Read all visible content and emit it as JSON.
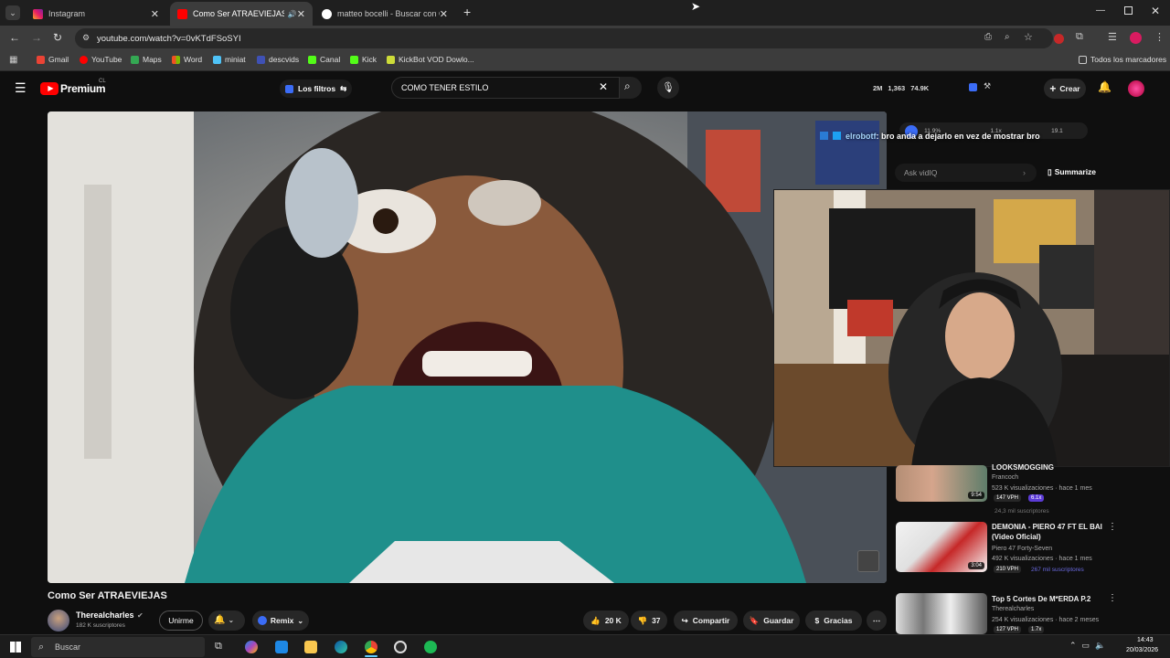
{
  "browser": {
    "tabs": [
      {
        "title": "Instagram",
        "active": false
      },
      {
        "title": "Como Ser ATRAEVIEJAS - Yo",
        "active": true
      },
      {
        "title": "matteo bocelli - Buscar con Go",
        "active": false
      }
    ],
    "url": "youtube.com/watch?v=0vKTdFSoSYI",
    "bookmarks": [
      "Gmail",
      "YouTube",
      "Maps",
      "Word",
      "miniat",
      "descvids",
      "Canal",
      "Kick",
      "KickBot VOD Dowlo..."
    ],
    "all_bookmarks": "Todos los marcadores"
  },
  "youtube": {
    "logo": "Premium",
    "logo_sup": "CL",
    "filters_label": "Los filtros",
    "search_value": "COMO TENER ESTILO",
    "stats": {
      "subs": "2M",
      "views": "1,363",
      "likes": "74.9K"
    },
    "create_label": "Crear"
  },
  "overlay": {
    "chat_user": "elrobotf",
    "chat_message": ": bro anda a dejarlo en vez de mostrar bro",
    "ask_placeholder": "Ask vidIQ",
    "summarize": "Summarize",
    "mini_stats": [
      "11.9%",
      "1.1x",
      "19.1"
    ]
  },
  "video": {
    "title": "Como Ser ATRAEVIEJAS",
    "channel": "Therealcharles",
    "subscribers": "182 K suscriptores",
    "join_label": "Unirme",
    "remix_label": "Remix",
    "likes": "20 K",
    "dislikes": "37",
    "share_label": "Compartir",
    "save_label": "Guardar",
    "thanks_label": "Gracias"
  },
  "recommendations": [
    {
      "title": "LOOKSMOGGING",
      "channel": "Francoch",
      "meta": "523 K visualizaciones · hace 1 mes",
      "duration": "9:54",
      "vph": "147 VPH",
      "ratio": "6.1x",
      "subs": "24,3 mil suscriptores"
    },
    {
      "title": "DEMONIA - PIERO 47 FT EL BAI (Video Oficial)",
      "channel": "Piero 47 Forty-Seven",
      "meta": "492 K visualizaciones · hace 1 mes",
      "duration": "3:04",
      "vph": "210 VPH",
      "ratio": "",
      "subs": "267 mil suscriptores"
    },
    {
      "title": "Top 5 Cortes De M*ERDA P.2",
      "channel": "Therealcharles",
      "meta": "254 K visualizaciones · hace 2 meses",
      "duration": "",
      "vph": "127 VPH",
      "ratio": "1.7x",
      "subs": ""
    }
  ],
  "taskbar": {
    "search_placeholder": "Buscar",
    "time": "14:43",
    "date": "20/03/2026"
  },
  "colors": {
    "yt_red": "#ff0000",
    "accent_blue": "#3ea6ff",
    "bg": "#0f0f0f"
  }
}
